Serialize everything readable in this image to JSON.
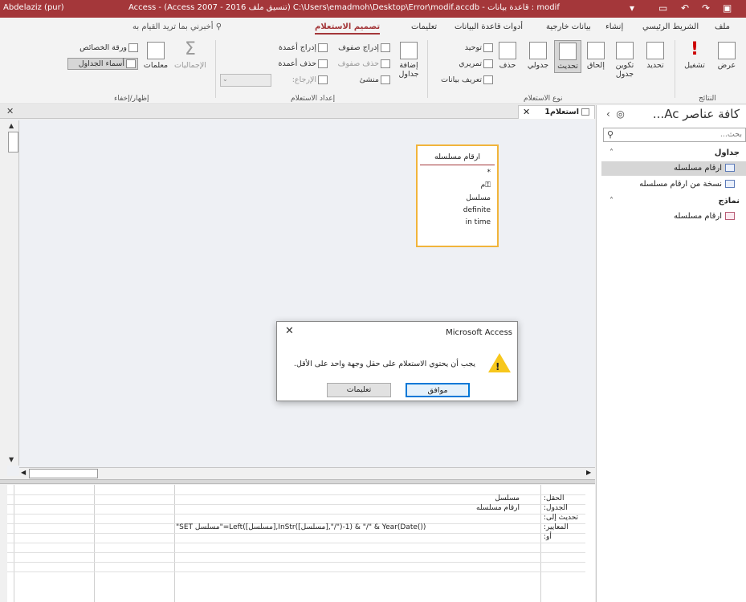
{
  "titlebar": {
    "user": "Abdelaziz (pur)",
    "title": "Access - (Access 2007 - 2016 تنسيق ملف) C:\\Users\\emadmoh\\Desktop\\Error\\modif.accdb - قاعدة بيانات : modif"
  },
  "tabs": {
    "file": "ملف",
    "home": "الشريط الرئيسي",
    "create": "إنشاء",
    "external": "بيانات خارجية",
    "dbtools": "أدوات قاعدة البيانات",
    "help": "تعليمات",
    "design": "تصميم الاستعلام",
    "tellme": "أخبرني بما تريد القيام به"
  },
  "ribbon": {
    "results": {
      "view": "عرض",
      "run": "تشغيل",
      "group": "النتائج"
    },
    "query_type": {
      "select": "تحديد",
      "make_table": "تكوين جدول",
      "append": "إلحاق",
      "update": "تحديث",
      "crosstab": "جدولي",
      "delete": "حذف",
      "union": "توحيد",
      "pass_through": "تمريري",
      "data_definition": "تعريف بيانات",
      "group": "نوع الاستعلام"
    },
    "setup": {
      "add_tables": "إضافة جداول",
      "insert_rows": "إدراج صفوف",
      "delete_rows": "حذف صفوف",
      "builder": "منشئ",
      "insert_columns": "إدراج أعمدة",
      "delete_columns": "حذف أعمدة",
      "return": "الإرجاع:",
      "group": "إعداد الاستعلام"
    },
    "show_hide": {
      "totals": "الإجماليات",
      "parameters": "معلمات",
      "property_sheet": "ورقة الخصائص",
      "table_names": "أسماء الجداول",
      "group": "إظهار/إخفاء"
    }
  },
  "nav": {
    "title": "كافة عناصر Ac...",
    "search_placeholder": "بحث...",
    "tables_header": "جداول",
    "forms_header": "نماذج",
    "tables": [
      "ارقام مسلسله",
      "نسخة من ارقام مسلسله"
    ],
    "forms": [
      "ارقام مسلسله"
    ]
  },
  "document": {
    "tab_label": "استعلام1"
  },
  "table_box": {
    "name": "ارقام مسلسله",
    "fields": [
      "*",
      "م",
      "مسلسل",
      "definite",
      "in time"
    ]
  },
  "grid": {
    "labels": {
      "field": "الحقل:",
      "table": "الجدول:",
      "update_to": "تحديث إلى:",
      "criteria": "المعايير:",
      "or": "أو:"
    },
    "field_value": "مسلسل",
    "table_value": "ارقام مسلسله",
    "update_value": "\"SET مسلسل\"=Left([مسلسل],InStr([مسلسل],\"/\")-1) & \"/\" & Year(Date())"
  },
  "dialog": {
    "title": "Microsoft Access",
    "message": "يجب أن يحتوي الاستعلام على حقل وجهة واحد على الأقل.",
    "ok": "موافق",
    "help": "تعليمات"
  },
  "colors": {
    "accent": "#a4373a",
    "table_border": "#f1b43b",
    "warning": "#f7c71c",
    "primary_button": "#0078d7"
  }
}
